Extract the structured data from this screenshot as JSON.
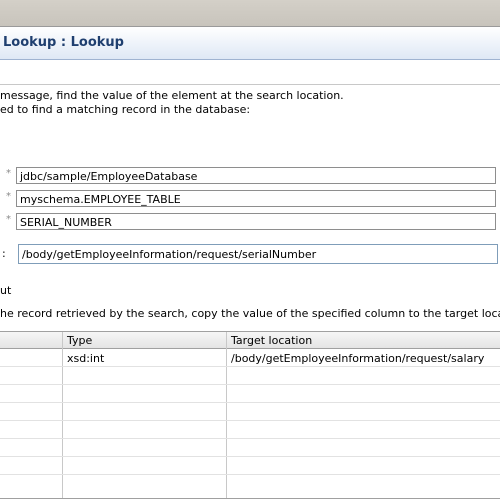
{
  "header": {
    "title": "Lookup : Lookup"
  },
  "description": {
    "line1": "message, find  the value of the element at the search location.",
    "line2": "ed to find a matching record in the database:"
  },
  "fields": {
    "required_mark": "*",
    "datasource": "jdbc/sample/EmployeeDatabase",
    "table": "myschema.EMPLOYEE_TABLE",
    "column": "SERIAL_NUMBER",
    "search_label_suffix": ":",
    "search_location": "/body/getEmployeeInformation/request/serialNumber"
  },
  "output": {
    "label": "ut",
    "description": "he record retrieved by the search, copy the value of the specified column to the target location"
  },
  "table": {
    "headers": [
      "Type",
      "Target location"
    ],
    "rows": [
      {
        "type": "xsd:int",
        "target": "/body/getEmployeeInformation/request/salary"
      }
    ]
  }
}
